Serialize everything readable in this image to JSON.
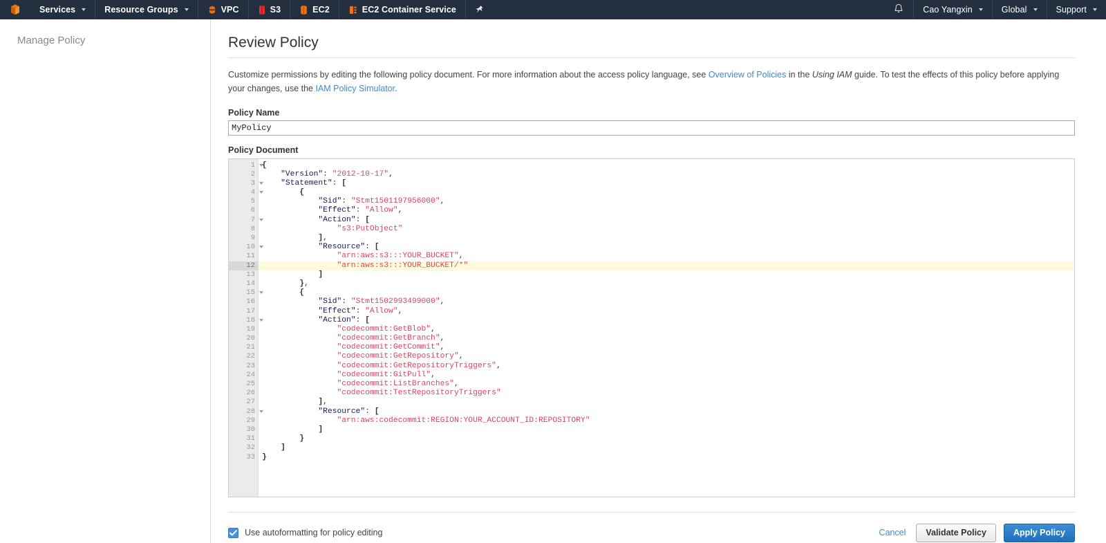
{
  "navbar": {
    "logo_icon": "aws-cube-icon",
    "left_items": [
      {
        "label": "Services",
        "icon": null,
        "caret": true
      },
      {
        "label": "Resource Groups",
        "icon": null,
        "caret": true
      },
      {
        "label": "VPC",
        "icon": "vpc-icon",
        "caret": false
      },
      {
        "label": "S3",
        "icon": "s3-icon",
        "caret": false
      },
      {
        "label": "EC2",
        "icon": "ec2-icon",
        "caret": false
      },
      {
        "label": "EC2 Container Service",
        "icon": "ecs-icon",
        "caret": false
      },
      {
        "label": "",
        "icon": "pin-icon",
        "caret": false
      }
    ],
    "bell_icon": "bell-icon",
    "right_items": [
      {
        "label": "Cao Yangxin",
        "caret": true
      },
      {
        "label": "Global",
        "caret": true
      },
      {
        "label": "Support",
        "caret": true
      }
    ],
    "background_color": "#232f3e"
  },
  "sidebar": {
    "title": "Manage Policy"
  },
  "page": {
    "title": "Review Policy",
    "description": {
      "part1": "Customize permissions by editing the following policy document. For more information about the access policy language, see ",
      "link1": "Overview of Policies",
      "part2": " in the ",
      "italic1": "Using IAM",
      "part3": " guide. To test the effects of this policy before applying your changes, use the ",
      "link2": "IAM Policy Simulator",
      "part4": "."
    }
  },
  "policy_name": {
    "label": "Policy Name",
    "value": "MyPolicy",
    "placeholder": "Policy Name"
  },
  "policy_document": {
    "label": "Policy Document",
    "active_line": 12,
    "fold_lines": [
      1,
      3,
      4,
      7,
      10,
      15,
      18,
      28
    ],
    "lines": [
      {
        "n": 1,
        "tokens": [
          {
            "t": "pun",
            "v": "{"
          }
        ]
      },
      {
        "n": 2,
        "tokens": [
          {
            "t": "plain",
            "v": "    "
          },
          {
            "t": "key",
            "v": "\"Version\""
          },
          {
            "t": "plain",
            "v": ": "
          },
          {
            "t": "str",
            "v": "\"2012-10-17\""
          },
          {
            "t": "plain",
            "v": ","
          }
        ]
      },
      {
        "n": 3,
        "tokens": [
          {
            "t": "plain",
            "v": "    "
          },
          {
            "t": "key",
            "v": "\"Statement\""
          },
          {
            "t": "plain",
            "v": ": "
          },
          {
            "t": "pun",
            "v": "["
          }
        ]
      },
      {
        "n": 4,
        "tokens": [
          {
            "t": "plain",
            "v": "        "
          },
          {
            "t": "pun",
            "v": "{"
          }
        ]
      },
      {
        "n": 5,
        "tokens": [
          {
            "t": "plain",
            "v": "            "
          },
          {
            "t": "key",
            "v": "\"Sid\""
          },
          {
            "t": "plain",
            "v": ": "
          },
          {
            "t": "str",
            "v": "\"Stmt1501197956000\""
          },
          {
            "t": "plain",
            "v": ","
          }
        ]
      },
      {
        "n": 6,
        "tokens": [
          {
            "t": "plain",
            "v": "            "
          },
          {
            "t": "key",
            "v": "\"Effect\""
          },
          {
            "t": "plain",
            "v": ": "
          },
          {
            "t": "str",
            "v": "\"Allow\""
          },
          {
            "t": "plain",
            "v": ","
          }
        ]
      },
      {
        "n": 7,
        "tokens": [
          {
            "t": "plain",
            "v": "            "
          },
          {
            "t": "key",
            "v": "\"Action\""
          },
          {
            "t": "plain",
            "v": ": "
          },
          {
            "t": "pun",
            "v": "["
          }
        ]
      },
      {
        "n": 8,
        "tokens": [
          {
            "t": "plain",
            "v": "                "
          },
          {
            "t": "str",
            "v": "\"s3:PutObject\""
          }
        ]
      },
      {
        "n": 9,
        "tokens": [
          {
            "t": "plain",
            "v": "            "
          },
          {
            "t": "pun",
            "v": "]"
          },
          {
            "t": "plain",
            "v": ","
          }
        ]
      },
      {
        "n": 10,
        "tokens": [
          {
            "t": "plain",
            "v": "            "
          },
          {
            "t": "key",
            "v": "\"Resource\""
          },
          {
            "t": "plain",
            "v": ": "
          },
          {
            "t": "pun",
            "v": "["
          }
        ]
      },
      {
        "n": 11,
        "tokens": [
          {
            "t": "plain",
            "v": "                "
          },
          {
            "t": "str",
            "v": "\"arn:aws:s3:::YOUR_BUCKET\""
          },
          {
            "t": "plain",
            "v": ","
          }
        ]
      },
      {
        "n": 12,
        "tokens": [
          {
            "t": "plain",
            "v": "                "
          },
          {
            "t": "str",
            "v": "\"arn:aws:s3:::YOUR_BUCKET/*\""
          }
        ]
      },
      {
        "n": 13,
        "tokens": [
          {
            "t": "plain",
            "v": "            "
          },
          {
            "t": "pun",
            "v": "]"
          }
        ]
      },
      {
        "n": 14,
        "tokens": [
          {
            "t": "plain",
            "v": "        "
          },
          {
            "t": "pun",
            "v": "}"
          },
          {
            "t": "plain",
            "v": ","
          }
        ]
      },
      {
        "n": 15,
        "tokens": [
          {
            "t": "plain",
            "v": "        "
          },
          {
            "t": "pun",
            "v": "{"
          }
        ]
      },
      {
        "n": 16,
        "tokens": [
          {
            "t": "plain",
            "v": "            "
          },
          {
            "t": "key",
            "v": "\"Sid\""
          },
          {
            "t": "plain",
            "v": ": "
          },
          {
            "t": "str",
            "v": "\"Stmt1502993499000\""
          },
          {
            "t": "plain",
            "v": ","
          }
        ]
      },
      {
        "n": 17,
        "tokens": [
          {
            "t": "plain",
            "v": "            "
          },
          {
            "t": "key",
            "v": "\"Effect\""
          },
          {
            "t": "plain",
            "v": ": "
          },
          {
            "t": "str",
            "v": "\"Allow\""
          },
          {
            "t": "plain",
            "v": ","
          }
        ]
      },
      {
        "n": 18,
        "tokens": [
          {
            "t": "plain",
            "v": "            "
          },
          {
            "t": "key",
            "v": "\"Action\""
          },
          {
            "t": "plain",
            "v": ": "
          },
          {
            "t": "pun",
            "v": "["
          }
        ]
      },
      {
        "n": 19,
        "tokens": [
          {
            "t": "plain",
            "v": "                "
          },
          {
            "t": "str",
            "v": "\"codecommit:GetBlob\""
          },
          {
            "t": "plain",
            "v": ","
          }
        ]
      },
      {
        "n": 20,
        "tokens": [
          {
            "t": "plain",
            "v": "                "
          },
          {
            "t": "str",
            "v": "\"codecommit:GetBranch\""
          },
          {
            "t": "plain",
            "v": ","
          }
        ]
      },
      {
        "n": 21,
        "tokens": [
          {
            "t": "plain",
            "v": "                "
          },
          {
            "t": "str",
            "v": "\"codecommit:GetCommit\""
          },
          {
            "t": "plain",
            "v": ","
          }
        ]
      },
      {
        "n": 22,
        "tokens": [
          {
            "t": "plain",
            "v": "                "
          },
          {
            "t": "str",
            "v": "\"codecommit:GetRepository\""
          },
          {
            "t": "plain",
            "v": ","
          }
        ]
      },
      {
        "n": 23,
        "tokens": [
          {
            "t": "plain",
            "v": "                "
          },
          {
            "t": "str",
            "v": "\"codecommit:GetRepositoryTriggers\""
          },
          {
            "t": "plain",
            "v": ","
          }
        ]
      },
      {
        "n": 24,
        "tokens": [
          {
            "t": "plain",
            "v": "                "
          },
          {
            "t": "str",
            "v": "\"codecommit:GitPull\""
          },
          {
            "t": "plain",
            "v": ","
          }
        ]
      },
      {
        "n": 25,
        "tokens": [
          {
            "t": "plain",
            "v": "                "
          },
          {
            "t": "str",
            "v": "\"codecommit:ListBranches\""
          },
          {
            "t": "plain",
            "v": ","
          }
        ]
      },
      {
        "n": 26,
        "tokens": [
          {
            "t": "plain",
            "v": "                "
          },
          {
            "t": "str",
            "v": "\"codecommit:TestRepositoryTriggers\""
          }
        ]
      },
      {
        "n": 27,
        "tokens": [
          {
            "t": "plain",
            "v": "            "
          },
          {
            "t": "pun",
            "v": "]"
          },
          {
            "t": "plain",
            "v": ","
          }
        ]
      },
      {
        "n": 28,
        "tokens": [
          {
            "t": "plain",
            "v": "            "
          },
          {
            "t": "key",
            "v": "\"Resource\""
          },
          {
            "t": "plain",
            "v": ": "
          },
          {
            "t": "pun",
            "v": "["
          }
        ]
      },
      {
        "n": 29,
        "tokens": [
          {
            "t": "plain",
            "v": "                "
          },
          {
            "t": "str",
            "v": "\"arn:aws:codecommit:REGION:YOUR_ACCOUNT_ID:REPOSITORY\""
          }
        ]
      },
      {
        "n": 30,
        "tokens": [
          {
            "t": "plain",
            "v": "            "
          },
          {
            "t": "pun",
            "v": "]"
          }
        ]
      },
      {
        "n": 31,
        "tokens": [
          {
            "t": "plain",
            "v": "        "
          },
          {
            "t": "pun",
            "v": "}"
          }
        ]
      },
      {
        "n": 32,
        "tokens": [
          {
            "t": "plain",
            "v": "    "
          },
          {
            "t": "pun",
            "v": "]"
          }
        ]
      },
      {
        "n": 33,
        "tokens": [
          {
            "t": "pun",
            "v": "}"
          }
        ]
      }
    ]
  },
  "footer": {
    "checkbox_label": "Use autoformatting for policy editing",
    "checkbox_checked": true,
    "cancel_label": "Cancel",
    "validate_label": "Validate Policy",
    "apply_label": "Apply Policy"
  },
  "colors": {
    "nav_bg": "#232f3e",
    "accent_orange": "#ec7211",
    "link_blue": "#3b8cd4",
    "primary_button": "#1f6fba",
    "json_key": "#18195e",
    "json_string": "#d9455f",
    "active_line": "#fefbdd"
  }
}
